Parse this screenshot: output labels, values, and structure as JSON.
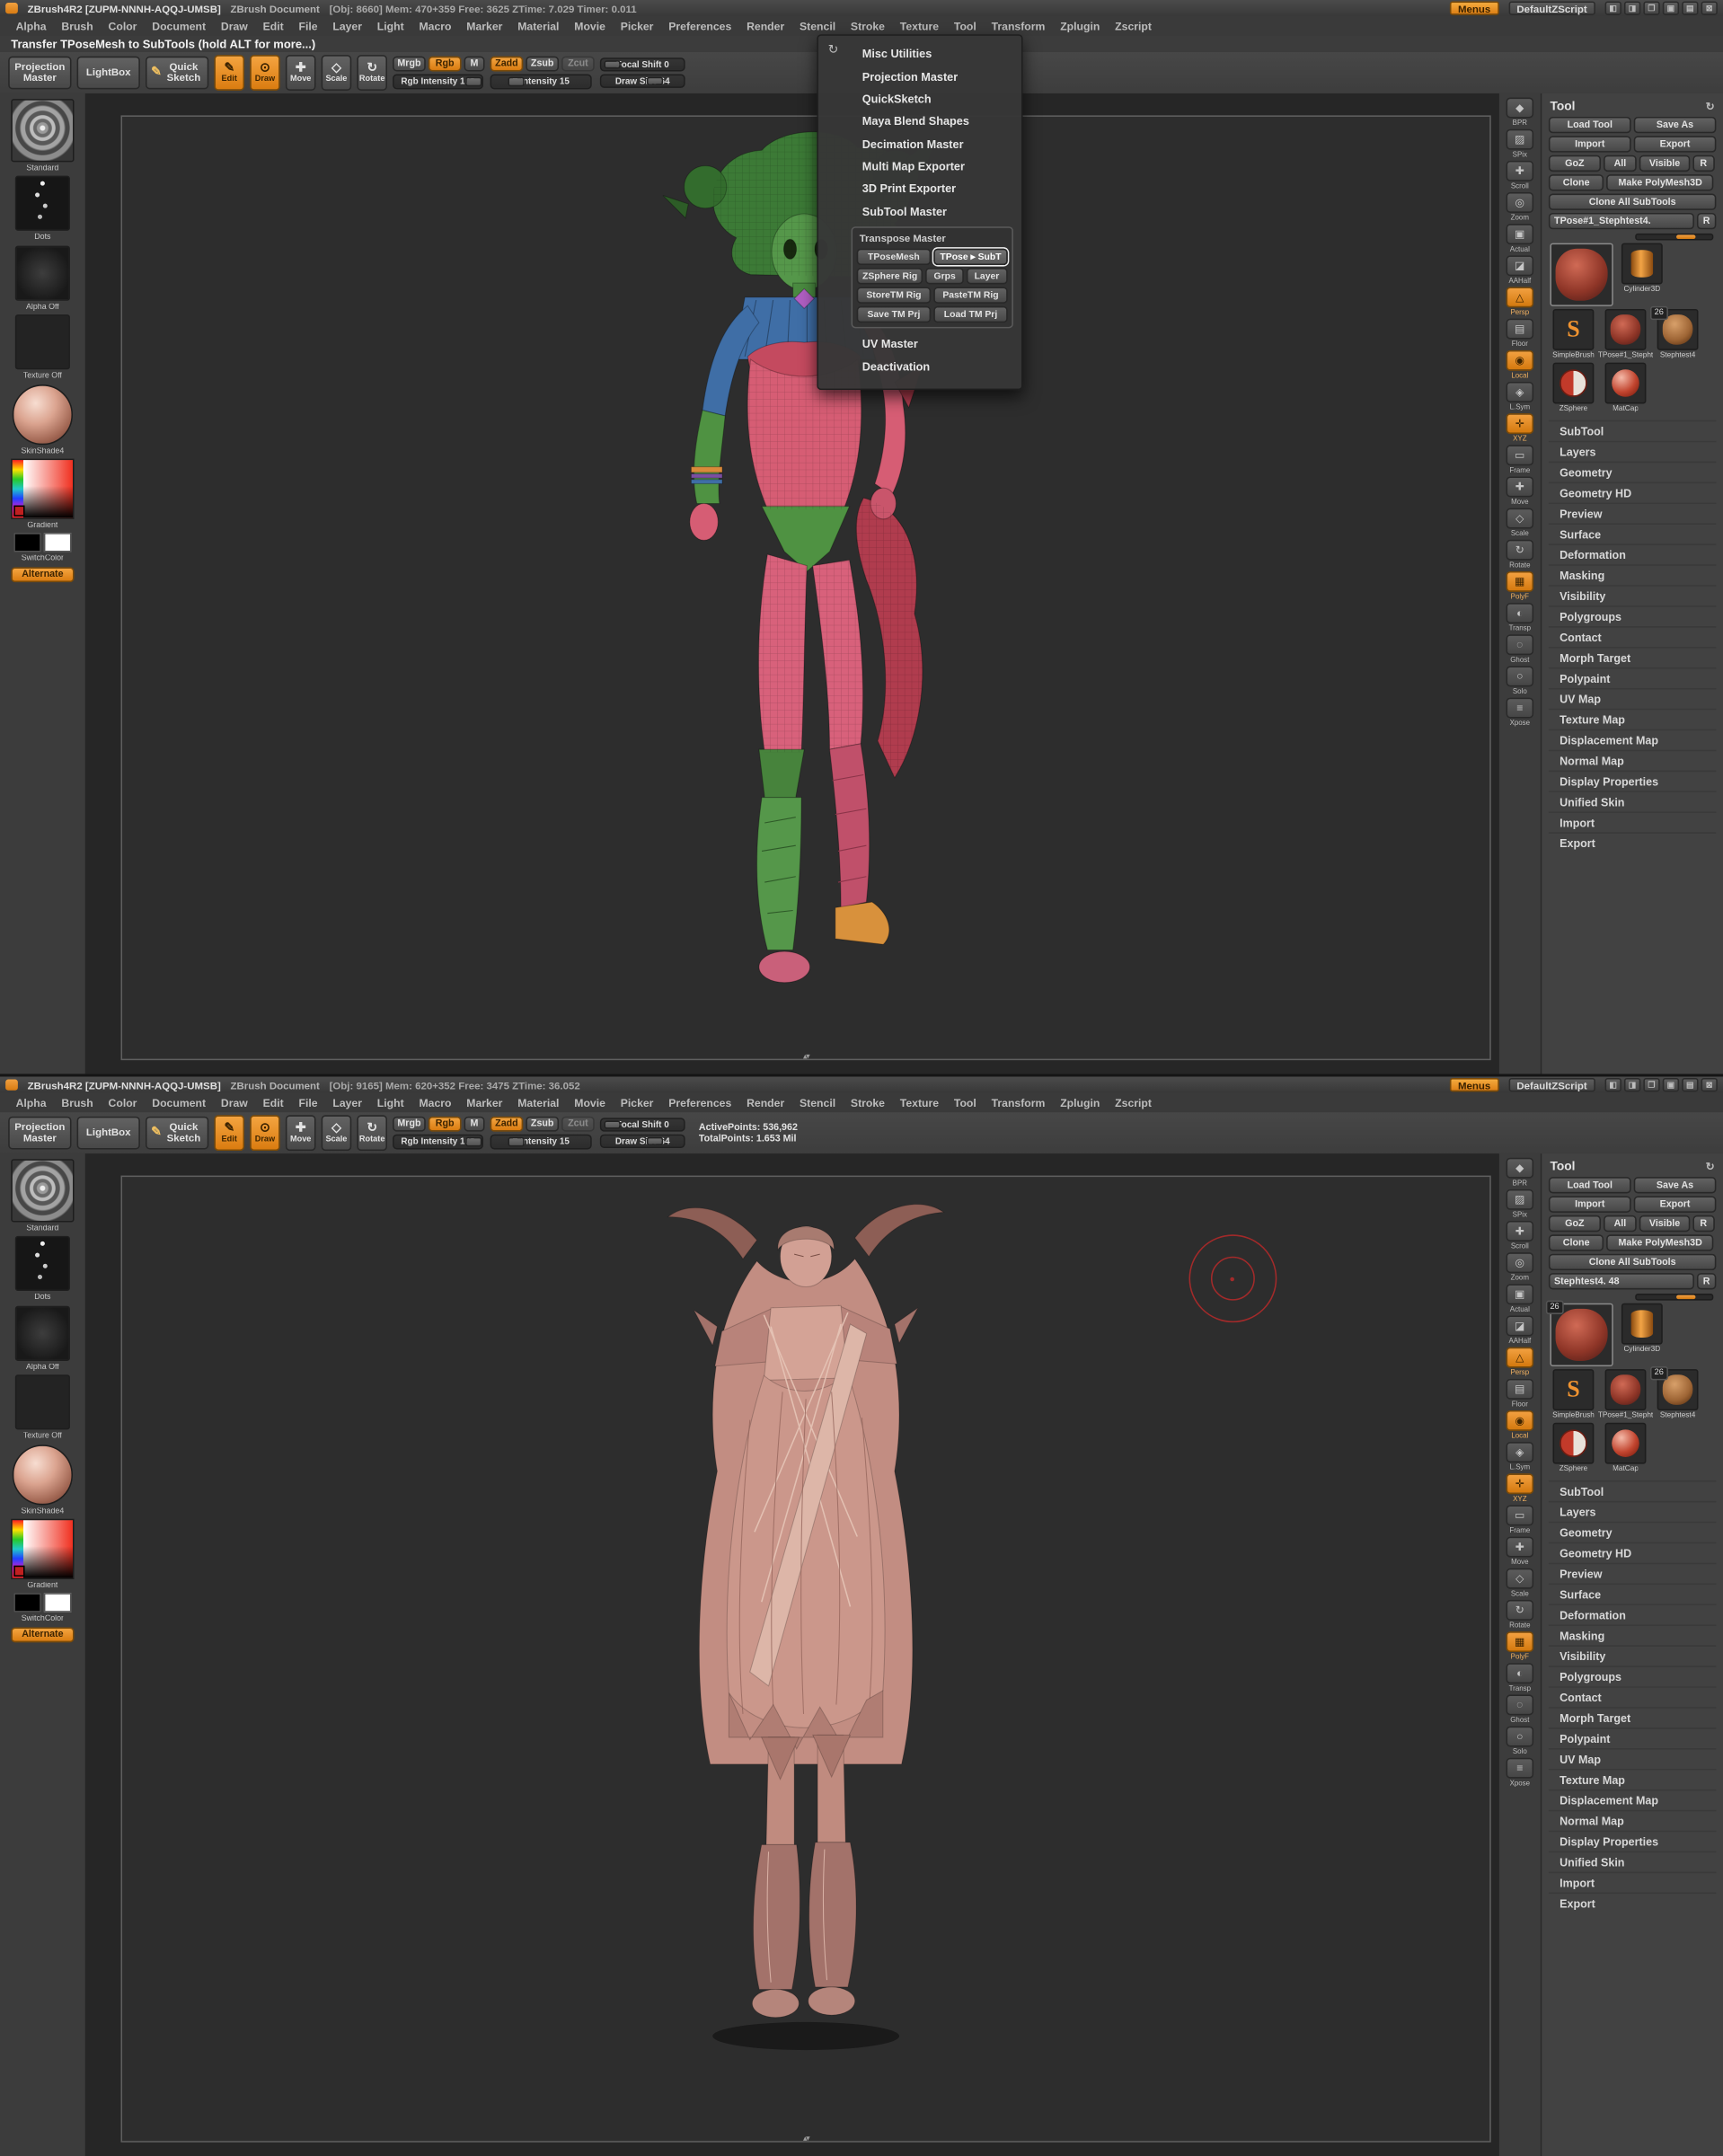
{
  "colors": {
    "accent": "#e8872b",
    "canvas": "#2d2d2d",
    "cursor_red": "#b82a2a"
  },
  "chrome": {
    "menus": [
      "Alpha",
      "Brush",
      "Color",
      "Document",
      "Draw",
      "Edit",
      "File",
      "Layer",
      "Light",
      "Macro",
      "Marker",
      "Material",
      "Movie",
      "Picker",
      "Preferences",
      "Render",
      "Stencil",
      "Stroke",
      "Texture",
      "Tool",
      "Transform",
      "Zplugin",
      "Zscript"
    ],
    "menus_button": "Menus",
    "zscript_button": "DefaultZScript",
    "window_icons": [
      {
        "glyph": "◧"
      },
      {
        "glyph": "◨"
      },
      {
        "glyph": "❐"
      },
      {
        "glyph": "▣"
      },
      {
        "glyph": "▤"
      },
      {
        "glyph": "⊠"
      }
    ]
  },
  "shelf": {
    "projection_master": "Projection Master",
    "lightbox": "LightBox",
    "quick_sketch": "Quick Sketch",
    "quick_sketch_icon": "✎",
    "edit": "Edit",
    "draw": "Draw",
    "move": "Move",
    "scale": "Scale",
    "rotate": "Rotate",
    "edit_icon": "✎",
    "draw_icon": "⊙",
    "move_icon": "✚",
    "scale_icon": "◇",
    "rotate_icon": "↻",
    "mrgb": "Mrgb",
    "rgb": "Rgb",
    "m": "M",
    "rgb_intensity": "Rgb Intensity 100",
    "zadd": "Zadd",
    "zsub": "Zsub",
    "zcut": "Zcut",
    "z_intensity": "Z Intensity 15",
    "focal_shift": "Focal Shift 0",
    "draw_size": "Draw Size 64"
  },
  "left_palette": {
    "brush_label": "Standard",
    "stroke_label": "Dots",
    "alpha_label": "Alpha Off",
    "texture_label": "Texture Off",
    "material_label": "SkinShade4",
    "gradient_label": "Gradient",
    "switch_label": "SwitchColor",
    "alternate_label": "Alternate"
  },
  "right_strip": [
    {
      "label": "BPR",
      "glyph": "◆",
      "state": ""
    },
    {
      "label": "SPix",
      "glyph": "▨",
      "state": ""
    },
    {
      "label": "Scroll",
      "glyph": "✚",
      "state": ""
    },
    {
      "label": "Zoom",
      "glyph": "◎",
      "state": ""
    },
    {
      "label": "Actual",
      "glyph": "▣",
      "state": ""
    },
    {
      "label": "AAHalf",
      "glyph": "◪",
      "state": ""
    },
    {
      "label": "Persp",
      "glyph": "△",
      "state": "on"
    },
    {
      "label": "Floor",
      "glyph": "▤",
      "state": ""
    },
    {
      "label": "Local",
      "glyph": "◉",
      "state": "on"
    },
    {
      "label": "L.Sym",
      "glyph": "◈",
      "state": ""
    },
    {
      "label": "XYZ",
      "glyph": "✛",
      "state": "on"
    },
    {
      "label": "Frame",
      "glyph": "▭",
      "state": ""
    },
    {
      "label": "Move",
      "glyph": "✚",
      "state": ""
    },
    {
      "label": "Scale",
      "glyph": "◇",
      "state": ""
    },
    {
      "label": "Rotate",
      "glyph": "↻",
      "state": ""
    },
    {
      "label": "PolyF",
      "glyph": "▦",
      "state": "on"
    },
    {
      "label": "Transp",
      "glyph": "◐",
      "state": ""
    },
    {
      "label": "Ghost",
      "glyph": "◌",
      "state": ""
    },
    {
      "label": "Solo",
      "glyph": "○",
      "state": ""
    },
    {
      "label": "Xpose",
      "glyph": "≡",
      "state": ""
    }
  ],
  "tool_panel": {
    "header": "Tool",
    "reload_icon": "↻",
    "buttons": [
      {
        "label": "Load Tool",
        "cls": "w48"
      },
      {
        "label": "Save As",
        "cls": "w48"
      },
      {
        "label": "Import",
        "cls": "w48"
      },
      {
        "label": "Export",
        "cls": "w48"
      },
      {
        "label": "GoZ",
        "cls": "w28"
      },
      {
        "label": "All",
        "cls": "w20"
      },
      {
        "label": "Visible",
        "cls": "w30"
      },
      {
        "label": "R",
        "cls": "w12"
      },
      {
        "label": "Clone",
        "cls": "w32"
      },
      {
        "label": "Make PolyMesh3D",
        "cls": "w62"
      },
      {
        "label": "Clone All SubTools",
        "cls": "w98"
      }
    ],
    "sections": [
      "SubTool",
      "Layers",
      "Geometry",
      "Geometry HD",
      "Preview",
      "Surface",
      "Deformation",
      "Masking",
      "Visibility",
      "Polygroups",
      "Contact",
      "Morph Target",
      "Polypaint",
      "UV Map",
      "Texture Map",
      "Displacement Map",
      "Normal Map",
      "Display Properties",
      "Unified Skin",
      "Import",
      "Export"
    ]
  },
  "win1": {
    "title": {
      "app": "ZBrush4R2 [ZUPM-NNNH-AQQJ-UMSB]",
      "doc": "ZBrush Document",
      "stats": "[Obj: 8660]   Mem: 470+359   Free: 3625   ZTime: 7.029   Timer: 0.011"
    },
    "help_text": "Transfer TPoseMesh to SubTools (hold ALT for more...)",
    "tool": {
      "name": "TPose#1_Stephtest4.",
      "r": "R",
      "thumbs": [
        {
          "label": "",
          "cls": "sculpt big",
          "badge": ""
        },
        {
          "label": "Cylinder3D",
          "cls": "cylinder",
          "badge": ""
        },
        {
          "label": "SimpleBrush",
          "cls": "sbrush",
          "badge": ""
        },
        {
          "label": "TPose#1_Stepht",
          "cls": "sculpt",
          "badge": ""
        },
        {
          "label": "Stephtest4",
          "cls": "sculpt tan",
          "badge": "26"
        },
        {
          "label": "ZSphere",
          "cls": "zsphere",
          "badge": ""
        },
        {
          "label": "MatCap",
          "cls": "matcap",
          "badge": ""
        }
      ]
    },
    "zplugin_menu": {
      "reload_icon": "↻",
      "items_top": [
        "Misc Utilities",
        "Projection Master",
        "QuickSketch",
        "Maya Blend Shapes",
        "Decimation Master",
        "Multi Map Exporter",
        "3D Print Exporter",
        "SubTool Master"
      ],
      "group_title": "Transpose Master",
      "group_buttons": [
        {
          "label": "TPoseMesh",
          "cls": "gw48"
        },
        {
          "label": "TPose ▸ SubT",
          "cls": "gw48 hl"
        },
        {
          "label": "ZSphere Rig",
          "cls": "gw44"
        },
        {
          "label": "Grps",
          "cls": "gw24"
        },
        {
          "label": "Layer",
          "cls": "gw26"
        },
        {
          "label": "StoreTM Rig",
          "cls": "gw48"
        },
        {
          "label": "PasteTM Rig",
          "cls": "gw48"
        },
        {
          "label": "Save TM Prj",
          "cls": "gw48"
        },
        {
          "label": "Load TM Prj",
          "cls": "gw48"
        }
      ],
      "items_bottom": [
        "UV Master",
        "Deactivation"
      ]
    }
  },
  "win2": {
    "title": {
      "app": "ZBrush4R2 [ZUPM-NNNH-AQQJ-UMSB]",
      "doc": "ZBrush Document",
      "stats": "[Obj: 9165]   Mem: 620+352   Free: 3475   ZTime: 36.052"
    },
    "points": {
      "active": "ActivePoints: 536,962",
      "total": "TotalPoints: 1.653 Mil"
    },
    "tool": {
      "name": "Stephtest4. 48",
      "r": "R",
      "thumbs": [
        {
          "label": "",
          "cls": "sculpt big",
          "badge": "26"
        },
        {
          "label": "Cylinder3D",
          "cls": "cylinder",
          "badge": ""
        },
        {
          "label": "SimpleBrush",
          "cls": "sbrush",
          "badge": ""
        },
        {
          "label": "TPose#1_Stepht",
          "cls": "sculpt",
          "badge": ""
        },
        {
          "label": "Stephtest4",
          "cls": "sculpt tan",
          "badge": "26"
        },
        {
          "label": "ZSphere",
          "cls": "zsphere",
          "badge": ""
        },
        {
          "label": "MatCap",
          "cls": "matcap",
          "badge": ""
        }
      ]
    }
  }
}
